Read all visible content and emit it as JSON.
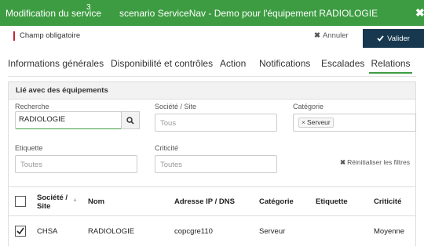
{
  "titlebar": {
    "title": "Modification du service",
    "superscript": "3",
    "subtitle": "scenario ServiceNav - Demo pour l'équipement RADIOLOGIE",
    "close": "✖"
  },
  "form": {
    "required_note": "Champ obligatoire",
    "cancel_label": "Annuler",
    "submit_label": "Valider"
  },
  "tabs": [
    {
      "label": "Informations générales"
    },
    {
      "label": "Disponibilité et contrôles"
    },
    {
      "label": "Action"
    },
    {
      "label": "Notifications"
    },
    {
      "label": "Escalades"
    },
    {
      "label": "Relations",
      "active": true
    }
  ],
  "panel": {
    "title": "Lié avec des équipements",
    "filters": {
      "search_label": "Recherche",
      "search_value": "RADIOLOGIE",
      "site_label": "Société / Site",
      "site_placeholder": "Tous",
      "category_label": "Catégorie",
      "category_tag": "Serveur",
      "tag_label": "Etiquette",
      "tag_placeholder": "Toutes",
      "criticity_label": "Criticité",
      "criticity_placeholder": "Toutes",
      "reset_label": "Réinitialiser les filtres"
    },
    "table": {
      "columns": {
        "site_line1": "Société /",
        "site_line2": "Site",
        "name": "Nom",
        "address": "Adresse IP / DNS",
        "category": "Catégorie",
        "tag": "Etiquette",
        "criticity": "Criticité"
      },
      "rows": [
        {
          "checked": true,
          "site": "CHSA",
          "name": "RADIOLOGIE",
          "address": "copcgre110",
          "category": "Serveur",
          "tag": "",
          "criticity": "Moyenne"
        }
      ]
    }
  },
  "colors": {
    "titlebar": "#3d9c42",
    "submit_button": "#17384f",
    "required_marker": "#c0272d",
    "active_tab_underline": "#3d9c42"
  },
  "icons": {
    "close": "close-icon",
    "cancel": "x-icon",
    "submit": "check-icon",
    "search": "search-icon",
    "sort": "sort-icon",
    "reset": "x-icon"
  }
}
